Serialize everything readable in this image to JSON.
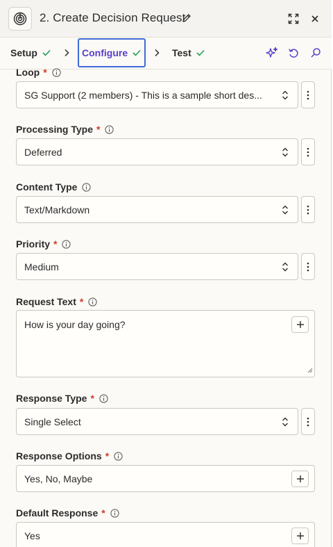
{
  "header": {
    "title": "2. Create Decision Request"
  },
  "tabs": [
    {
      "label": "Setup",
      "done": true
    },
    {
      "label": "Configure",
      "done": true,
      "active": true
    },
    {
      "label": "Test",
      "done": true
    }
  ],
  "colors": {
    "accent_purple": "#5a3ccc",
    "check_green": "#1f9d55",
    "required_red": "#d33a2c",
    "active_border": "#3f6ad8"
  },
  "fields": {
    "loop": {
      "label": "Loop",
      "required": true,
      "value": "SG Support (2 members) - This is a sample short des..."
    },
    "processing_type": {
      "label": "Processing Type",
      "required": true,
      "value": "Deferred"
    },
    "content_type": {
      "label": "Content Type",
      "required": false,
      "value": "Text/Markdown"
    },
    "priority": {
      "label": "Priority",
      "required": true,
      "value": "Medium"
    },
    "request_text": {
      "label": "Request Text",
      "required": true,
      "value": "How is your day going?"
    },
    "response_type": {
      "label": "Response Type",
      "required": true,
      "value": "Single Select"
    },
    "response_options": {
      "label": "Response Options",
      "required": true,
      "value": "Yes, No, Maybe"
    },
    "default_response": {
      "label": "Default Response",
      "required": true,
      "value": "Yes"
    }
  },
  "required_mark": "*",
  "icons": [
    "app-logo-icon",
    "pencil-icon",
    "expand-icon",
    "close-icon",
    "check-icon",
    "chevron-right-icon",
    "sparkle-icon",
    "undo-icon",
    "search-icon",
    "info-icon",
    "updown-icon",
    "kebab-icon",
    "plus-icon",
    "resize-icon"
  ]
}
